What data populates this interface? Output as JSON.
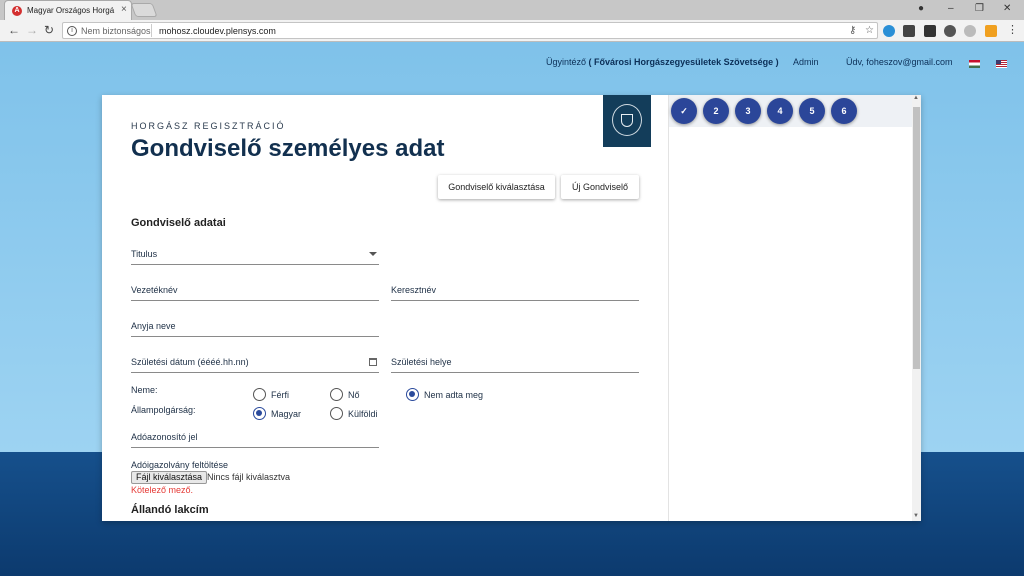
{
  "browser": {
    "tab_title": "Magyar Országos Horgá",
    "tab_close": "×",
    "security_label": "Nem biztonságos",
    "url": "mohosz.cloudev.plensys.com"
  },
  "header": {
    "role_label": "Ügyintéző",
    "organization": "( Fővárosi Horgászegyesületek Szövetsége )",
    "admin_link": "Admin",
    "greeting": "Üdv, foheszov@gmail.com",
    "colors": {
      "top_gradient": "#7fc2ea",
      "bottom_band": "#0c3a6e"
    }
  },
  "form": {
    "subtitle": "HORGÁSZ REGISZTRÁCIÓ",
    "title": "Gondviselő személyes adat",
    "select_guardian_button": "Gondviselő kiválasztása",
    "new_guardian_button": "Új Gondviselő",
    "section_guardian": "Gondviselő adatai",
    "title_field": "Titulus",
    "last_name": "Vezetéknév",
    "first_name": "Keresztnév",
    "mother_name": "Anyja neve",
    "birth_date": "Születési dátum (éééé.hh.nn)",
    "birth_place": "Születési helye",
    "gender_label": "Neme:",
    "gender_options": [
      "Férfi",
      "Nő",
      "Nem adta meg"
    ],
    "gender_selected": "Nem adta meg",
    "citizenship_label": "Állampolgárság:",
    "citizenship_options": [
      "Magyar",
      "Külföldi"
    ],
    "citizenship_selected": "Magyar",
    "tax_id": "Adóazonosító jel",
    "upload_label": "Adóigazolvány feltöltése",
    "file_button": "Fájl kiválasztása",
    "file_status": "Nincs fájl kiválasztva",
    "required_text": "Kötelező mező.",
    "section_address": "Állandó lakcím",
    "accent_color": "#2b4699",
    "error_color": "#e53935"
  },
  "steps": {
    "items": [
      "✓",
      "2",
      "3",
      "4",
      "5",
      "6"
    ],
    "current": 1
  }
}
